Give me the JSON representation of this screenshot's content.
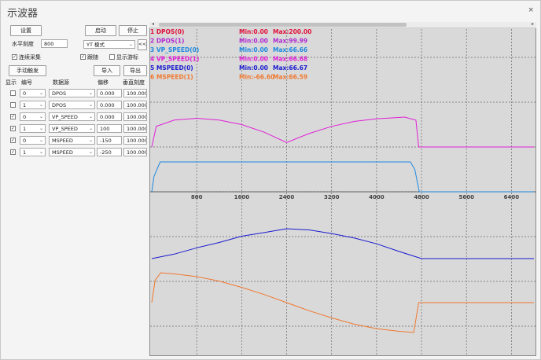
{
  "window": {
    "title": "示波器",
    "close_glyph": "×"
  },
  "controls": {
    "settings_label": "设置",
    "start_label": "启动",
    "stop_label": "停止",
    "hscale_label": "水平刻度",
    "hscale_value": "800",
    "mode_value": "YT 模式",
    "collapse_glyph": "<<",
    "continuous_label": "连续采集",
    "follow_label": "跟随",
    "show_cursor_label": "显示游标",
    "manual_trigger_label": "手动触发",
    "import_label": "导入",
    "export_label": "导出"
  },
  "table": {
    "headers": [
      "显示",
      "编号",
      "数据源",
      "偏移",
      "垂直刻度"
    ],
    "rows": [
      {
        "checked": false,
        "num": "0",
        "source": "DPOS",
        "offset": "0.000",
        "scale": "100.000"
      },
      {
        "checked": false,
        "num": "1",
        "source": "DPOS",
        "offset": "0.000",
        "scale": "100.000"
      },
      {
        "checked": true,
        "num": "0",
        "source": "VP_SPEED",
        "offset": "0.000",
        "scale": "100.000"
      },
      {
        "checked": true,
        "num": "1",
        "source": "VP_SPEED",
        "offset": "100",
        "scale": "100.000"
      },
      {
        "checked": true,
        "num": "0",
        "source": "MSPEED",
        "offset": "-150",
        "scale": "100.000"
      },
      {
        "checked": true,
        "num": "1",
        "source": "MSPEED",
        "offset": "-250",
        "scale": "100.000"
      }
    ]
  },
  "legend": [
    {
      "name": "1 DPOS(0)",
      "min": "Min:0.00",
      "max": "Max:200.00",
      "color": "#e0103a"
    },
    {
      "name": "2 DPOS(1)",
      "min": "Min:0.00",
      "max": "Max:99.99",
      "color": "#b02ad0"
    },
    {
      "name": "3 VP_SPEED(0)",
      "min": "Min:0.00",
      "max": "Max:66.66",
      "color": "#1e88e0"
    },
    {
      "name": "4 VP_SPEED(1)",
      "min": "Min:0.00",
      "max": "Max:66.68",
      "color": "#e020d8"
    },
    {
      "name": "5 MSPEED(0)",
      "min": "Min:0.00",
      "max": "Max:66.67",
      "color": "#1a1ad0"
    },
    {
      "name": "6 MSPEED(1)",
      "min": "Min:-66.60",
      "max": "Max:66.59",
      "color": "#f07830"
    }
  ],
  "chart_data": {
    "type": "line",
    "x_ticks": [
      "800",
      "1600",
      "2400",
      "3200",
      "4000",
      "4800",
      "5600",
      "6400"
    ],
    "xlim": [
      0,
      6800
    ],
    "series": [
      {
        "name": "4 VP_SPEED(1)",
        "color": "#e020d8",
        "x": [
          0,
          80,
          400,
          800,
          1200,
          1600,
          2000,
          2400,
          2800,
          3200,
          3600,
          4000,
          4500,
          4700,
          4750,
          6800
        ],
        "y": [
          0,
          46,
          60,
          64,
          60,
          50,
          33,
          10,
          30,
          46,
          57,
          63,
          66.68,
          60,
          0,
          0
        ]
      },
      {
        "name": "3 VP_SPEED(0)",
        "color": "#1e88e0",
        "x": [
          0,
          40,
          150,
          4600,
          4680,
          4760,
          6800
        ],
        "y": [
          0,
          35,
          66.66,
          66.66,
          50,
          0,
          0
        ]
      },
      {
        "name": "5 MSPEED(0)",
        "color": "#1a1ad0",
        "x": [
          0,
          400,
          800,
          1200,
          1600,
          2000,
          2400,
          2800,
          3200,
          3600,
          4000,
          4400,
          4800,
          6800
        ],
        "y": [
          0,
          10,
          24,
          36,
          50,
          58,
          66.67,
          64,
          56,
          46,
          33,
          16,
          0,
          0
        ]
      },
      {
        "name": "6 MSPEED(1)",
        "color": "#f07830",
        "x": [
          0,
          60,
          160,
          400,
          800,
          1200,
          1600,
          2000,
          2400,
          2800,
          3200,
          3600,
          4000,
          4400,
          4660,
          4750,
          6800
        ],
        "y": [
          0,
          50,
          66.59,
          64,
          58,
          48,
          34,
          18,
          0,
          -18,
          -34,
          -48,
          -58,
          -64,
          -66.6,
          0,
          0
        ]
      }
    ]
  }
}
